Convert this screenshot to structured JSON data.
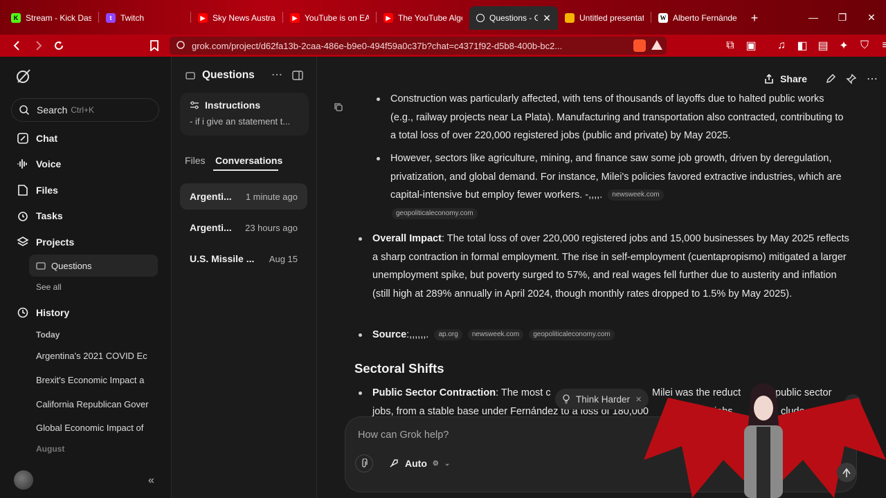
{
  "browser": {
    "tabs": [
      {
        "title": "Stream - Kick Dash",
        "icon": "kick-icon",
        "color": "#53fc18"
      },
      {
        "title": "Twitch",
        "icon": "twitch-icon",
        "color": "#9146ff"
      },
      {
        "title": "Sky News Australi",
        "icon": "youtube-icon",
        "color": "#ff0000"
      },
      {
        "title": "YouTube is on EA",
        "icon": "youtube-icon",
        "color": "#ff0000"
      },
      {
        "title": "The YouTube Algo",
        "icon": "youtube-icon",
        "color": "#ff0000"
      },
      {
        "title": "Questions - G",
        "icon": "grok-icon",
        "color": "#ffffff",
        "active": true
      },
      {
        "title": "Untitled presentat",
        "icon": "slides-icon",
        "color": "#f4b400"
      },
      {
        "title": "Alberto Fernánde",
        "icon": "wikipedia-icon",
        "color": "#ffffff"
      }
    ],
    "url": "grok.com/project/d62fa13b-2caa-486e-b9e0-494f59a0c37b?chat=c4371f92-d5b8-400b-bc2..."
  },
  "sidebar": {
    "search_label": "Search",
    "search_shortcut": "Ctrl+K",
    "nav": [
      {
        "label": "Chat",
        "icon": "chat-icon"
      },
      {
        "label": "Voice",
        "icon": "voice-icon"
      },
      {
        "label": "Files",
        "icon": "files-icon"
      },
      {
        "label": "Tasks",
        "icon": "tasks-icon"
      },
      {
        "label": "Projects",
        "icon": "projects-icon"
      }
    ],
    "project_selected": "Questions",
    "see_all": "See all",
    "history_label": "History",
    "today_label": "Today",
    "history_today": [
      "Argentina's 2021 COVID Ec",
      "Brexit's Economic Impact a",
      "California Republican Gover",
      "Global Economic Impact of"
    ],
    "august_label": "August"
  },
  "project_panel": {
    "title": "Questions",
    "instructions_label": "Instructions",
    "instructions_preview": "- if i give an statement t...",
    "tabs": [
      "Files",
      "Conversations"
    ],
    "active_tab": "Conversations",
    "conversations": [
      {
        "title": "Argenti...",
        "time": "1 minute ago"
      },
      {
        "title": "Argenti...",
        "time": "23 hours ago"
      },
      {
        "title": "U.S. Missile ...",
        "time": "Aug 15"
      }
    ]
  },
  "main": {
    "share_label": "Share",
    "bullet_construction": "Construction was particularly affected, with tens of thousands of layoffs due to halted public works (e.g., railway projects near La Plata). Manufacturing and transportation also contracted, contributing to a total loss of over 220,000 registered jobs (public and private) by May 2025.",
    "bullet_sectors": "However, sectors like agriculture, mining, and finance saw some job growth, driven by deregulation, privatization, and global demand. For instance, Milei's policies favored extractive industries, which are capital-intensive but employ fewer workers. -,,,,.",
    "chip_newsweek": "newsweek.com",
    "chip_geopolitical": "geopoliticaleconomy.com",
    "overall_label": "Overall Impact",
    "overall_text": ": The total loss of over 220,000 registered jobs and 15,000 businesses by May 2025 reflects a sharp contraction in formal employment. The rise in self-employment (cuentapropismo) mitigated a larger unemployment spike, but poverty surged to 57%, and real wages fell further due to austerity and inflation (still high at 289% annually in April 2024, though monthly rates dropped to 1.5% by May 2025).",
    "source_label": "Source",
    "source_text": ":,,,,,,.",
    "source_chips": [
      "ap.org",
      "newsweek.com",
      "geopoliticaleconomy.com"
    ],
    "heading_sectoral": "Sectoral Shifts",
    "public_label": "Public Sector Contraction",
    "public_text_a": ": The most c",
    "public_text_b": "Milei was the reduct",
    "public_text_c": "public sector",
    "public_line2_a": "jobs, from a stable base under Fernández to a loss of 180,000",
    "public_line2_b": "jobs.",
    "public_line2_c": "clude",
    "think_harder": "Think Harder",
    "composer_placeholder": "How can Grok help?",
    "mode_label": "Auto"
  }
}
